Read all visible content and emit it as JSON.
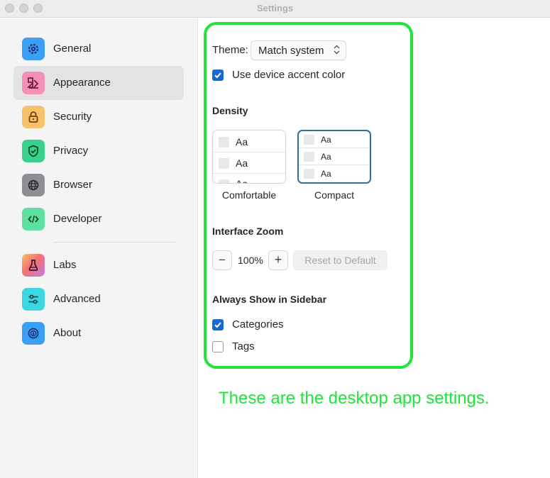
{
  "window": {
    "title": "Settings"
  },
  "sidebar": {
    "items": [
      {
        "label": "General",
        "icon": "gear-icon",
        "color": "#3b9ff5",
        "selected": false
      },
      {
        "label": "Appearance",
        "icon": "palette-icon",
        "color": "#f48fb8",
        "selected": true
      },
      {
        "label": "Security",
        "icon": "lock-icon",
        "color": "#f7c26b",
        "selected": false
      },
      {
        "label": "Privacy",
        "icon": "shield-check-icon",
        "color": "#3ad28a",
        "selected": false
      },
      {
        "label": "Browser",
        "icon": "globe-icon",
        "color": "#8e8f94",
        "selected": false
      },
      {
        "label": "Developer",
        "icon": "code-icon",
        "color": "#5ee0a0",
        "selected": false
      },
      {
        "label": "Labs",
        "icon": "flask-icon",
        "color": "#f2726e",
        "selected": false
      },
      {
        "label": "Advanced",
        "icon": "sliders-icon",
        "color": "#3ed6e0",
        "selected": false
      },
      {
        "label": "About",
        "icon": "info-icon",
        "color": "#3b9ff5",
        "selected": false
      }
    ]
  },
  "appearance": {
    "theme_label": "Theme:",
    "theme_value": "Match system",
    "accent_label": "Use device accent color",
    "accent_checked": true,
    "density_heading": "Density",
    "density_sample": "Aa",
    "density_options": [
      {
        "label": "Comfortable",
        "selected": false
      },
      {
        "label": "Compact",
        "selected": true
      }
    ],
    "zoom_heading": "Interface Zoom",
    "zoom_minus": "−",
    "zoom_value": "100%",
    "zoom_plus": "+",
    "reset_label": "Reset to Default",
    "sidebar_heading": "Always Show in Sidebar",
    "categories_label": "Categories",
    "categories_checked": true,
    "tags_label": "Tags",
    "tags_checked": false
  },
  "annotation": {
    "text": "These are the desktop app settings.",
    "color": "#1fe43a"
  }
}
